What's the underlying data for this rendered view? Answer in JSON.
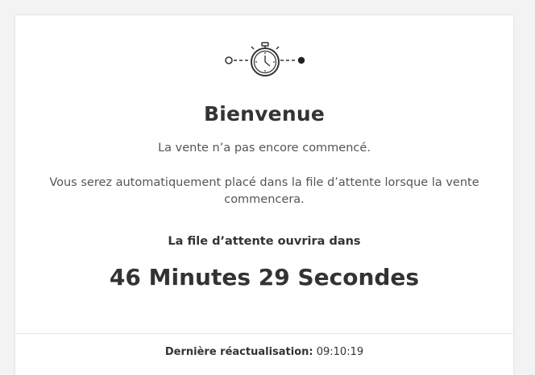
{
  "header": {
    "icon": "stopwatch-icon"
  },
  "main": {
    "title": "Bienvenue",
    "subtitle": "La vente n’a pas encore commencé.",
    "info": "Vous serez automatiquement placé dans la file d’attente lorsque la vente commencera.",
    "opens_label": "La file d’attente ouvrira dans",
    "countdown": "46 Minutes 29 Secondes"
  },
  "footer": {
    "last_refresh_label": "Dernière réactualisation:",
    "last_refresh_time": "09:10:19"
  }
}
